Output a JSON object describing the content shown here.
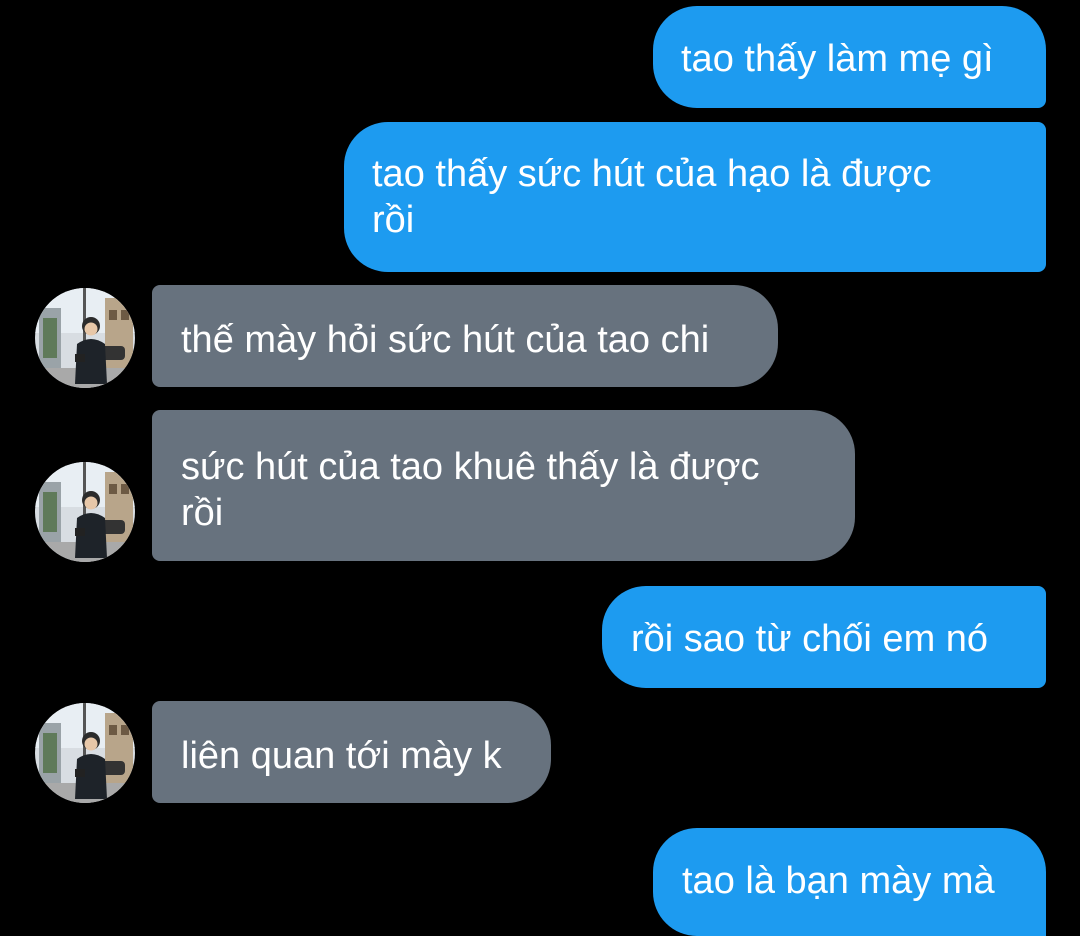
{
  "colors": {
    "background": "#000000",
    "outgoing_bubble": "#1d9bf0",
    "incoming_bubble": "#67727e",
    "text": "#ffffff"
  },
  "messages": [
    {
      "direction": "out",
      "text": "tao thấy làm mẹ gì"
    },
    {
      "direction": "out",
      "text": "tao thấy sức hút của hạo là được\nrồi"
    },
    {
      "direction": "in",
      "text": "thế mày hỏi sức hút của tao chi",
      "avatar": "contact-avatar"
    },
    {
      "direction": "in",
      "text": "sức hút của tao khuê thấy là được\nrồi",
      "avatar": "contact-avatar"
    },
    {
      "direction": "out",
      "text": "rồi sao từ chối em nó"
    },
    {
      "direction": "in",
      "text": "liên quan tới mày k",
      "avatar": "contact-avatar"
    },
    {
      "direction": "out",
      "text": "tao là bạn mày mà"
    }
  ]
}
